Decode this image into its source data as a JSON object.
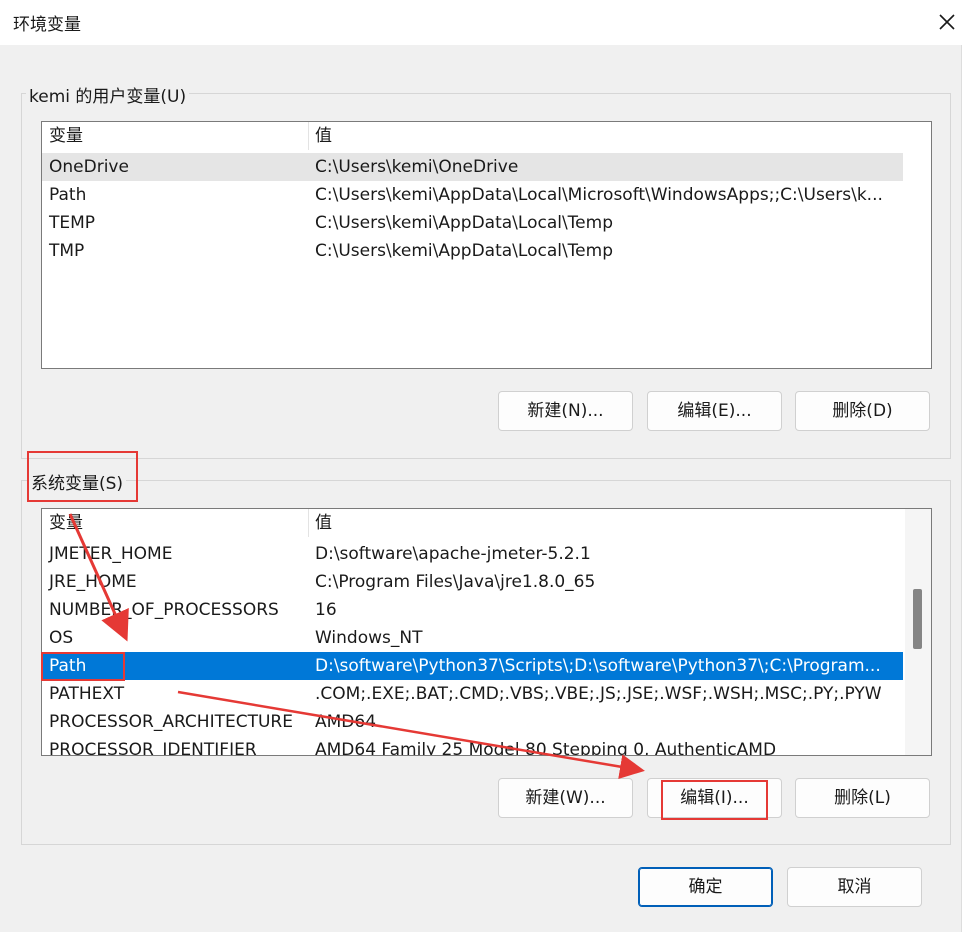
{
  "window": {
    "title": "环境变量"
  },
  "user_vars": {
    "group_label": "kemi 的用户变量(U)",
    "columns": [
      "变量",
      "值"
    ],
    "rows": [
      {
        "name": "OneDrive",
        "value": "C:\\Users\\kemi\\OneDrive"
      },
      {
        "name": "Path",
        "value": "C:\\Users\\kemi\\AppData\\Local\\Microsoft\\WindowsApps;;C:\\Users\\k..."
      },
      {
        "name": "TEMP",
        "value": "C:\\Users\\kemi\\AppData\\Local\\Temp"
      },
      {
        "name": "TMP",
        "value": "C:\\Users\\kemi\\AppData\\Local\\Temp"
      }
    ],
    "buttons": {
      "new": "新建(N)...",
      "edit": "编辑(E)...",
      "delete": "删除(D)"
    }
  },
  "system_vars": {
    "group_label": "系统变量(S)",
    "columns": [
      "变量",
      "值"
    ],
    "rows": [
      {
        "name": "JMETER_HOME",
        "value": "D:\\software\\apache-jmeter-5.2.1"
      },
      {
        "name": "JRE_HOME",
        "value": "C:\\Program Files\\Java\\jre1.8.0_65"
      },
      {
        "name": "NUMBER_OF_PROCESSORS",
        "value": "16"
      },
      {
        "name": "OS",
        "value": "Windows_NT"
      },
      {
        "name": "Path",
        "value": "D:\\software\\Python37\\Scripts\\;D:\\software\\Python37\\;C:\\Program..."
      },
      {
        "name": "PATHEXT",
        "value": ".COM;.EXE;.BAT;.CMD;.VBS;.VBE;.JS;.JSE;.WSF;.WSH;.MSC;.PY;.PYW"
      },
      {
        "name": "PROCESSOR_ARCHITECTURE",
        "value": "AMD64"
      },
      {
        "name": "PROCESSOR_IDENTIFIER",
        "value": "AMD64 Family 25 Model 80 Stepping 0, AuthenticAMD"
      }
    ],
    "selected_row": 4,
    "buttons": {
      "new": "新建(W)...",
      "edit": "编辑(I)...",
      "delete": "删除(L)"
    }
  },
  "footer": {
    "ok": "确定",
    "cancel": "取消"
  },
  "icons": {
    "close": "close-icon"
  },
  "colors": {
    "selection": "#0078d7",
    "annotation": "#e53935",
    "accent_border": "#005fb8"
  }
}
